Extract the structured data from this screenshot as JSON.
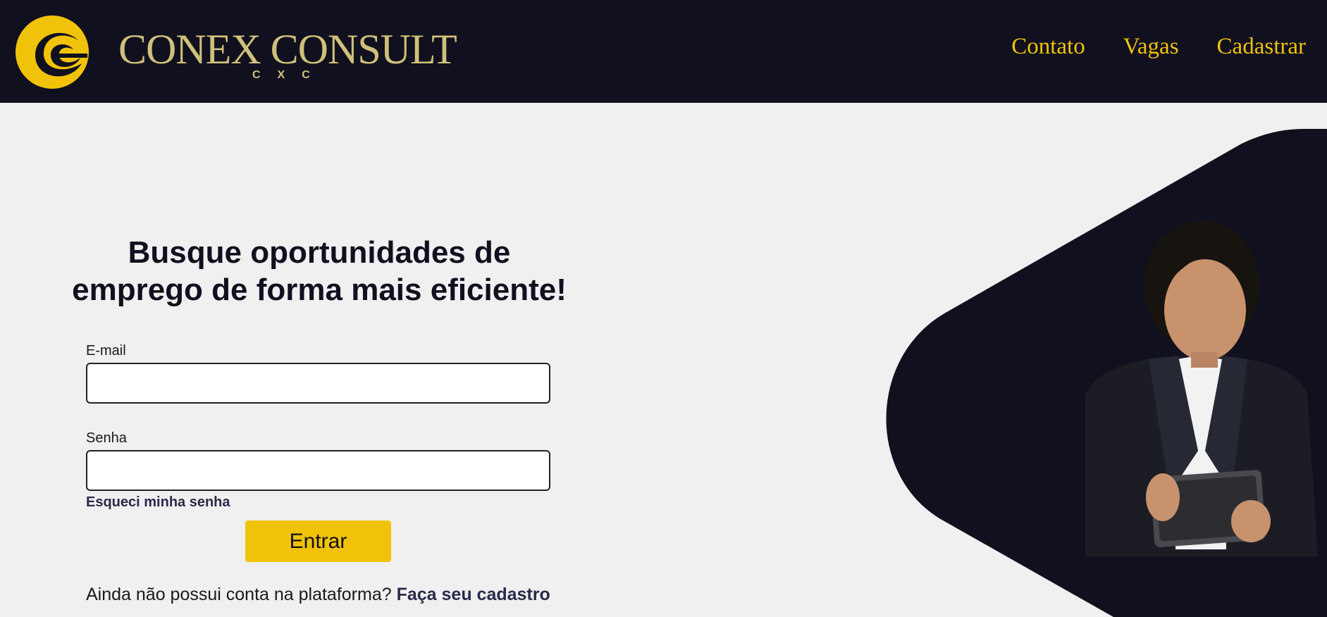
{
  "header": {
    "brand_name": "CONEX CONSULT",
    "brand_sub": "CXC",
    "nav": [
      {
        "label": "Contato"
      },
      {
        "label": "Vagas"
      },
      {
        "label": "Cadastrar"
      }
    ]
  },
  "main": {
    "headline_line1": "Busque oportunidades de",
    "headline_line2": "emprego de forma mais eficiente!",
    "email_label": "E-mail",
    "email_value": "",
    "password_label": "Senha",
    "password_value": "",
    "forgot_password": "Esqueci minha senha",
    "submit_label": "Entrar",
    "signup_prompt": "Ainda não possui conta na plataforma?",
    "signup_link": "Faça seu cadastro"
  },
  "colors": {
    "header_bg": "#11101f",
    "accent_yellow": "#f0c30a",
    "brand_gold": "#cfc07a",
    "page_bg": "#f0f0f0"
  },
  "icons": {
    "logo": "conex-logo-icon",
    "hero": "businesswoman-tablet-photo"
  }
}
